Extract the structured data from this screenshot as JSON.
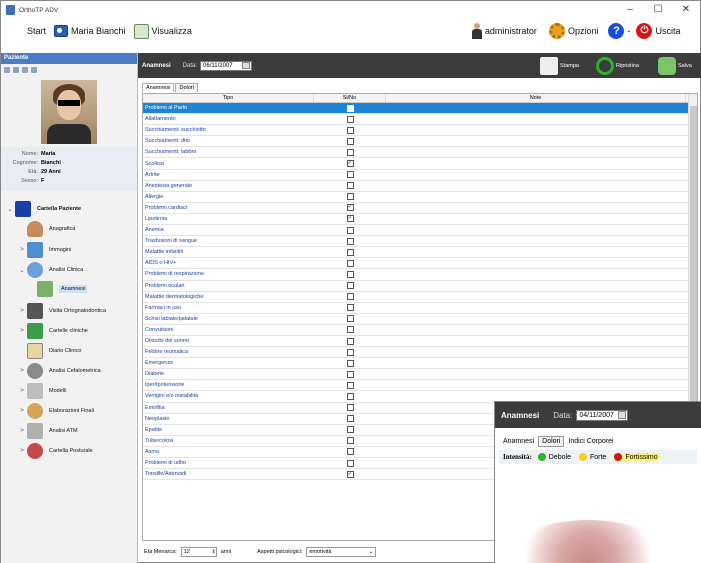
{
  "window": {
    "title": "OrthoTP ADV",
    "controls": [
      "–",
      "☐",
      "✕"
    ]
  },
  "menubar": {
    "start": "Start",
    "user": "Maria Bianchi",
    "view": "Visualizza",
    "admin": "administrator",
    "options": "Opzioni",
    "help": "?",
    "dash": "-",
    "exit": "Uscita"
  },
  "sidebar": {
    "header": "Paziente",
    "patient": {
      "labels": [
        "Nome:",
        "Cognome:",
        "Età:",
        "Sesso:"
      ],
      "values": [
        "Maria",
        "Bianchi",
        "29 Anni",
        "F"
      ]
    },
    "tree": [
      {
        "label": "Cartella Paziente",
        "expander": "⌄",
        "color": "#1a3fa6"
      },
      {
        "label": "Anagrafica",
        "expander": "",
        "color": "#c58a5a"
      },
      {
        "label": "Immagini",
        "expander": ">",
        "color": "#4f8fd1"
      },
      {
        "label": "Analisi Clinica",
        "expander": "⌄",
        "color": "#6aa0d8"
      },
      {
        "label": "Anamnesi",
        "expander": "",
        "color": "#7cb06a"
      },
      {
        "label": "Visita Ortognatodontica",
        "expander": ">",
        "color": "#555555"
      },
      {
        "label": "Cartelle cliniche",
        "expander": ">",
        "color": "#3f9b4a"
      },
      {
        "label": "Diario Clinico",
        "expander": "",
        "color": "#e6d7a0"
      },
      {
        "label": "Analisi Cefalometrica",
        "expander": ">",
        "color": "#8a8a8a"
      },
      {
        "label": "Modelli",
        "expander": ">",
        "color": "#bdbdbd"
      },
      {
        "label": "Elaborazioni Finali",
        "expander": ">",
        "color": "#d6a35c"
      },
      {
        "label": "Analisi ATM",
        "expander": ">",
        "color": "#b0b0b0"
      },
      {
        "label": "Cartella Posturale",
        "expander": ">",
        "color": "#c44a4a"
      }
    ]
  },
  "main": {
    "section": "Anamnesi",
    "date_label": "Data:",
    "date": "06/11/2007",
    "actions": [
      "Stampa",
      "Ripristina",
      "Salva"
    ],
    "tabs": [
      "Anamnesi",
      "Dolori"
    ],
    "columns": [
      "Tipo",
      "Si/No",
      "Note"
    ],
    "rows": [
      {
        "tipo": "Problemi al Parto",
        "checked": false
      },
      {
        "tipo": "Allattamento",
        "checked": false
      },
      {
        "tipo": "Succhiamenti: succhiotto",
        "checked": false
      },
      {
        "tipo": "Succhiamenti: dito",
        "checked": false
      },
      {
        "tipo": "Succhiamenti: labbro",
        "checked": false
      },
      {
        "tipo": "Scoliosi",
        "checked": true
      },
      {
        "tipo": "Artrite",
        "checked": false
      },
      {
        "tipo": "Anestesia generale",
        "checked": false
      },
      {
        "tipo": "Allergie",
        "checked": false
      },
      {
        "tipo": "Problemi cardiaci",
        "checked": true
      },
      {
        "tipo": "Lipotimia",
        "checked": true
      },
      {
        "tipo": "Anemia",
        "checked": false
      },
      {
        "tipo": "Trasfusioni di sangue",
        "checked": false
      },
      {
        "tipo": "Malattie infantili",
        "checked": false
      },
      {
        "tipo": "AIDS o HIV+",
        "checked": false
      },
      {
        "tipo": "Problemi di respirazione",
        "checked": false
      },
      {
        "tipo": "Problemi oculari",
        "checked": false
      },
      {
        "tipo": "Malattie dermatologiche",
        "checked": false
      },
      {
        "tipo": "Farmaci in uso",
        "checked": false
      },
      {
        "tipo": "Schisi labiale/palatale",
        "checked": false
      },
      {
        "tipo": "Convulsioni",
        "checked": false
      },
      {
        "tipo": "Disturbi del sonno",
        "checked": false
      },
      {
        "tipo": "Febbre reumatica",
        "checked": false
      },
      {
        "tipo": "Emergenze",
        "checked": false
      },
      {
        "tipo": "Diabete",
        "checked": false
      },
      {
        "tipo": "Iper/Ipotensione",
        "checked": false
      },
      {
        "tipo": "Vertigini e/o instabilità",
        "checked": false
      },
      {
        "tipo": "Emofilia",
        "checked": false
      },
      {
        "tipo": "Neoplasie",
        "checked": false
      },
      {
        "tipo": "Epatite",
        "checked": false
      },
      {
        "tipo": "Tubercolosi",
        "checked": false
      },
      {
        "tipo": "Asma",
        "checked": false
      },
      {
        "tipo": "Problemi di udito",
        "checked": false
      },
      {
        "tipo": "Tonsille/Adenoidi",
        "checked": true
      }
    ],
    "menarca_label": "Età Menarca:",
    "menarca_value": "12",
    "menarca_unit": "anni",
    "psico_label": "Aspetti psicologici:",
    "psico_value": "emotività"
  },
  "overlay": {
    "section": "Anamnesi",
    "date_label": "Data:",
    "date": "04/11/2007",
    "tabs": [
      "Anamnesi",
      "Dolori",
      "Indici Corporei"
    ],
    "intensity_label": "Intensità:",
    "levels": [
      {
        "label": "Debole",
        "color": "#2bb52b"
      },
      {
        "label": "Forte",
        "color": "#f2d21b"
      },
      {
        "label": "Fortissimo",
        "color": "#c81818"
      }
    ]
  },
  "colors": {
    "accent": "#1e84d6",
    "header_dark": "#3c3c3c",
    "sidebar_header": "#4a7cc4"
  }
}
